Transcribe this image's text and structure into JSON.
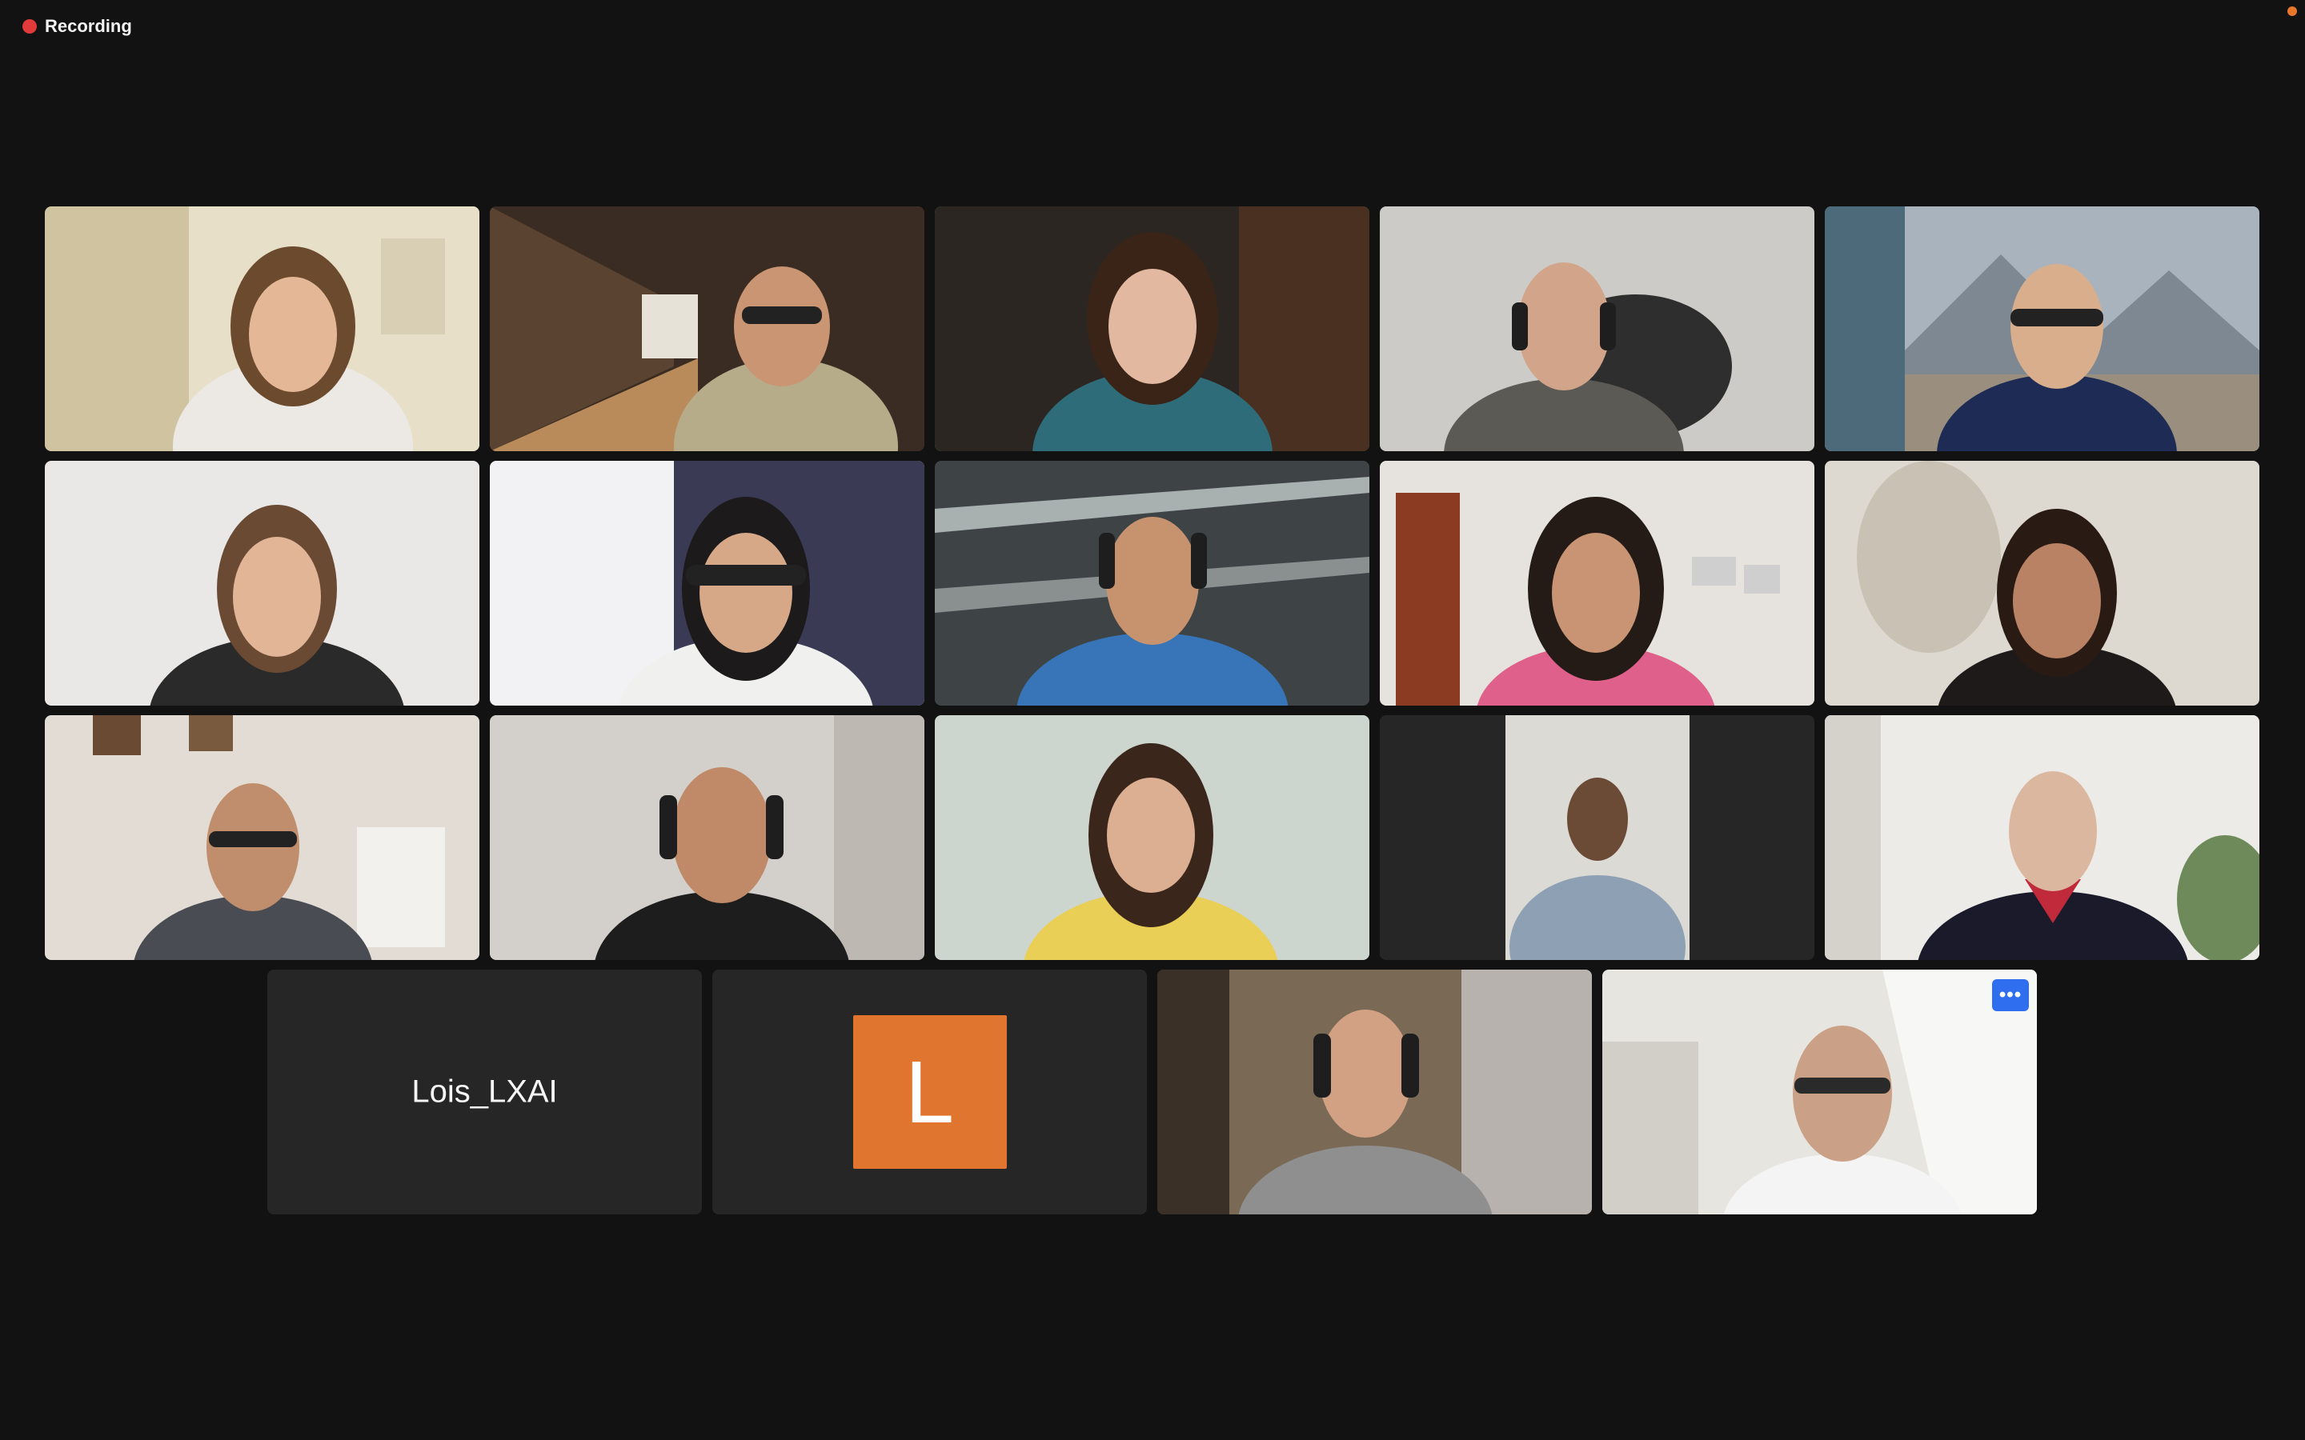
{
  "recording": {
    "label": "Recording",
    "color": "#e03a3a"
  },
  "accent": {
    "active_speaker_border": "#6fdc6a",
    "more_button": "#2f6fef",
    "avatar_bg": "#e07530"
  },
  "participants": [
    {
      "type": "video",
      "icon": "participant-video"
    },
    {
      "type": "video",
      "icon": "participant-video"
    },
    {
      "type": "video",
      "icon": "participant-video",
      "active_speaker": true
    },
    {
      "type": "video",
      "icon": "participant-video"
    },
    {
      "type": "video",
      "icon": "participant-video"
    },
    {
      "type": "video",
      "icon": "participant-video"
    },
    {
      "type": "video",
      "icon": "participant-video"
    },
    {
      "type": "video",
      "icon": "participant-video"
    },
    {
      "type": "video",
      "icon": "participant-video"
    },
    {
      "type": "video",
      "icon": "participant-video"
    },
    {
      "type": "video",
      "icon": "participant-video"
    },
    {
      "type": "video",
      "icon": "participant-video"
    },
    {
      "type": "video",
      "icon": "participant-video"
    },
    {
      "type": "video",
      "icon": "participant-video"
    },
    {
      "type": "video",
      "icon": "participant-video"
    },
    {
      "type": "name",
      "name": "Lois_LXAI"
    },
    {
      "type": "avatar",
      "initial": "L"
    },
    {
      "type": "video",
      "icon": "participant-video"
    },
    {
      "type": "video",
      "icon": "participant-video",
      "more_button": "•••"
    }
  ]
}
